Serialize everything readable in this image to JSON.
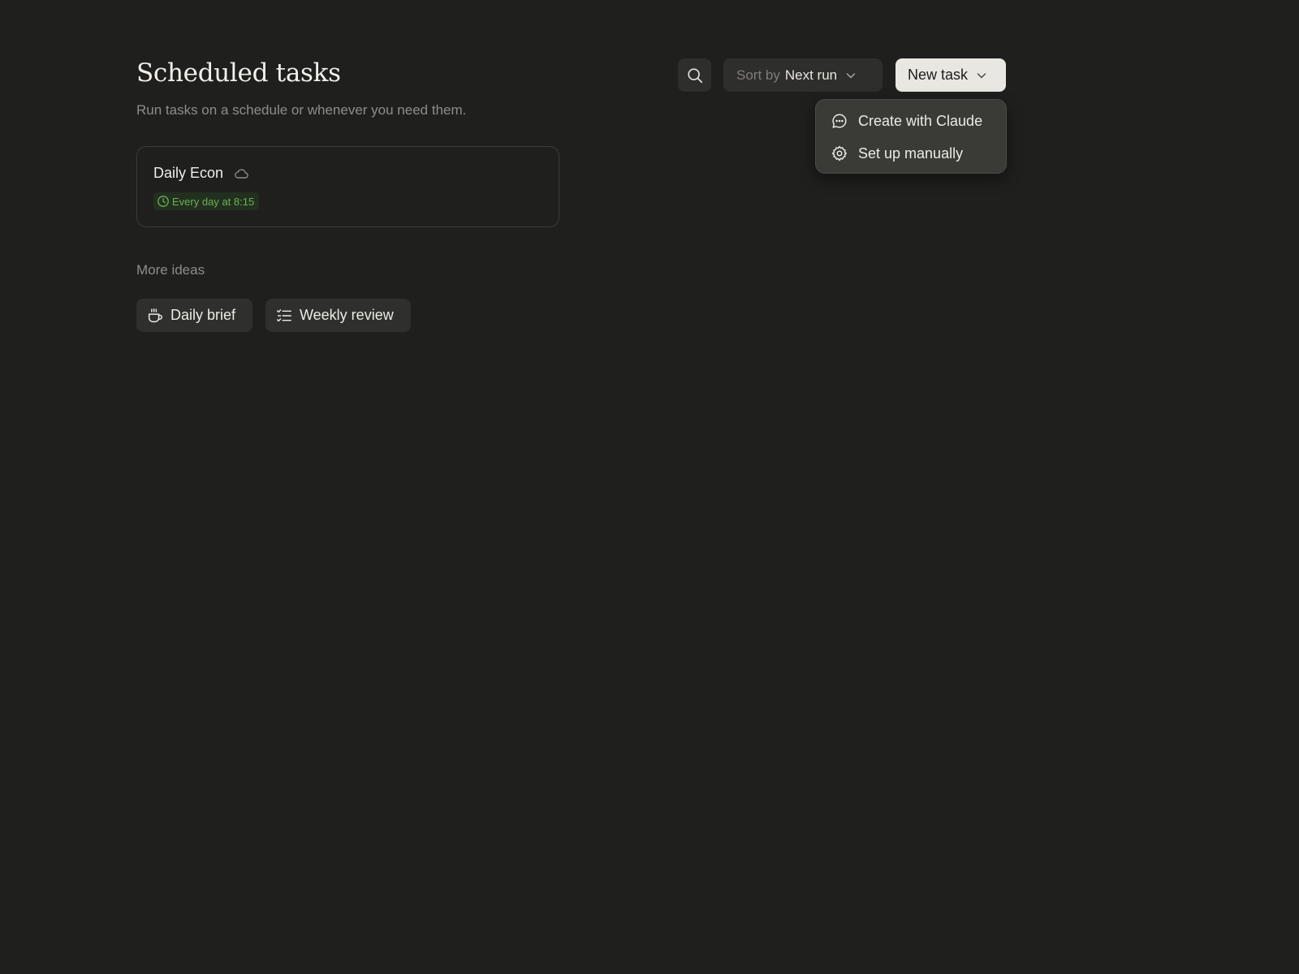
{
  "header": {
    "title": "Scheduled tasks",
    "subtitle": "Run tasks on a schedule or whenever you need them."
  },
  "toolbar": {
    "search_icon": "search-icon",
    "sort_prefix": "Sort by",
    "sort_value": "Next run",
    "new_task_label": "New task"
  },
  "new_task_menu": {
    "items": [
      {
        "label": "Create with Claude",
        "icon": "chat-bubble-icon"
      },
      {
        "label": "Set up manually",
        "icon": "gear-icon"
      }
    ]
  },
  "tasks": [
    {
      "name": "Daily Econ",
      "icon": "cloud-icon",
      "schedule": "Every day at 8:15",
      "schedule_color": "#6fae55"
    }
  ],
  "ideas": {
    "heading": "More ideas",
    "items": [
      {
        "label": "Daily brief",
        "icon": "coffee-cup-icon"
      },
      {
        "label": "Weekly review",
        "icon": "checklist-icon"
      }
    ]
  },
  "colors": {
    "background": "#1f1f1e",
    "primary_button": "#e9e7e1",
    "schedule_green": "#6fae55"
  }
}
